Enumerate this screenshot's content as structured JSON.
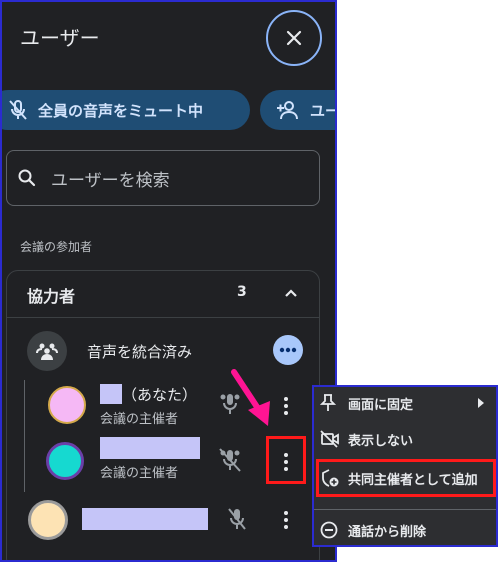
{
  "header": {
    "title": "ユーザー"
  },
  "chips": {
    "mute_all": "全員の音声をミュート中",
    "add_users": "ユー"
  },
  "search": {
    "placeholder": "ユーザーを検索"
  },
  "section": {
    "label": "会議の参加者"
  },
  "group": {
    "title": "協力者",
    "count": "3",
    "merged": {
      "label": "音声を統合済み"
    },
    "members": [
      {
        "name_suffix": "（あなた）",
        "role": "会議の主催者"
      },
      {
        "name_suffix": "",
        "role": "会議の主催者"
      },
      {
        "name_suffix": "",
        "role": ""
      }
    ]
  },
  "context_menu": {
    "items": [
      {
        "label": "画面に固定",
        "icon": "pin-icon"
      },
      {
        "label": "表示しない",
        "icon": "hide-video-icon"
      },
      {
        "label": "共同主催者として追加",
        "icon": "add-cohost-icon"
      },
      {
        "label": "通話から削除",
        "icon": "remove-circle-icon"
      }
    ]
  },
  "colors": {
    "panel_bg": "#202124",
    "chip_bg": "#1f4d74",
    "accent": "#8ab4f8",
    "highlight": "#ff1a1a",
    "arrow": "#ff1493"
  }
}
